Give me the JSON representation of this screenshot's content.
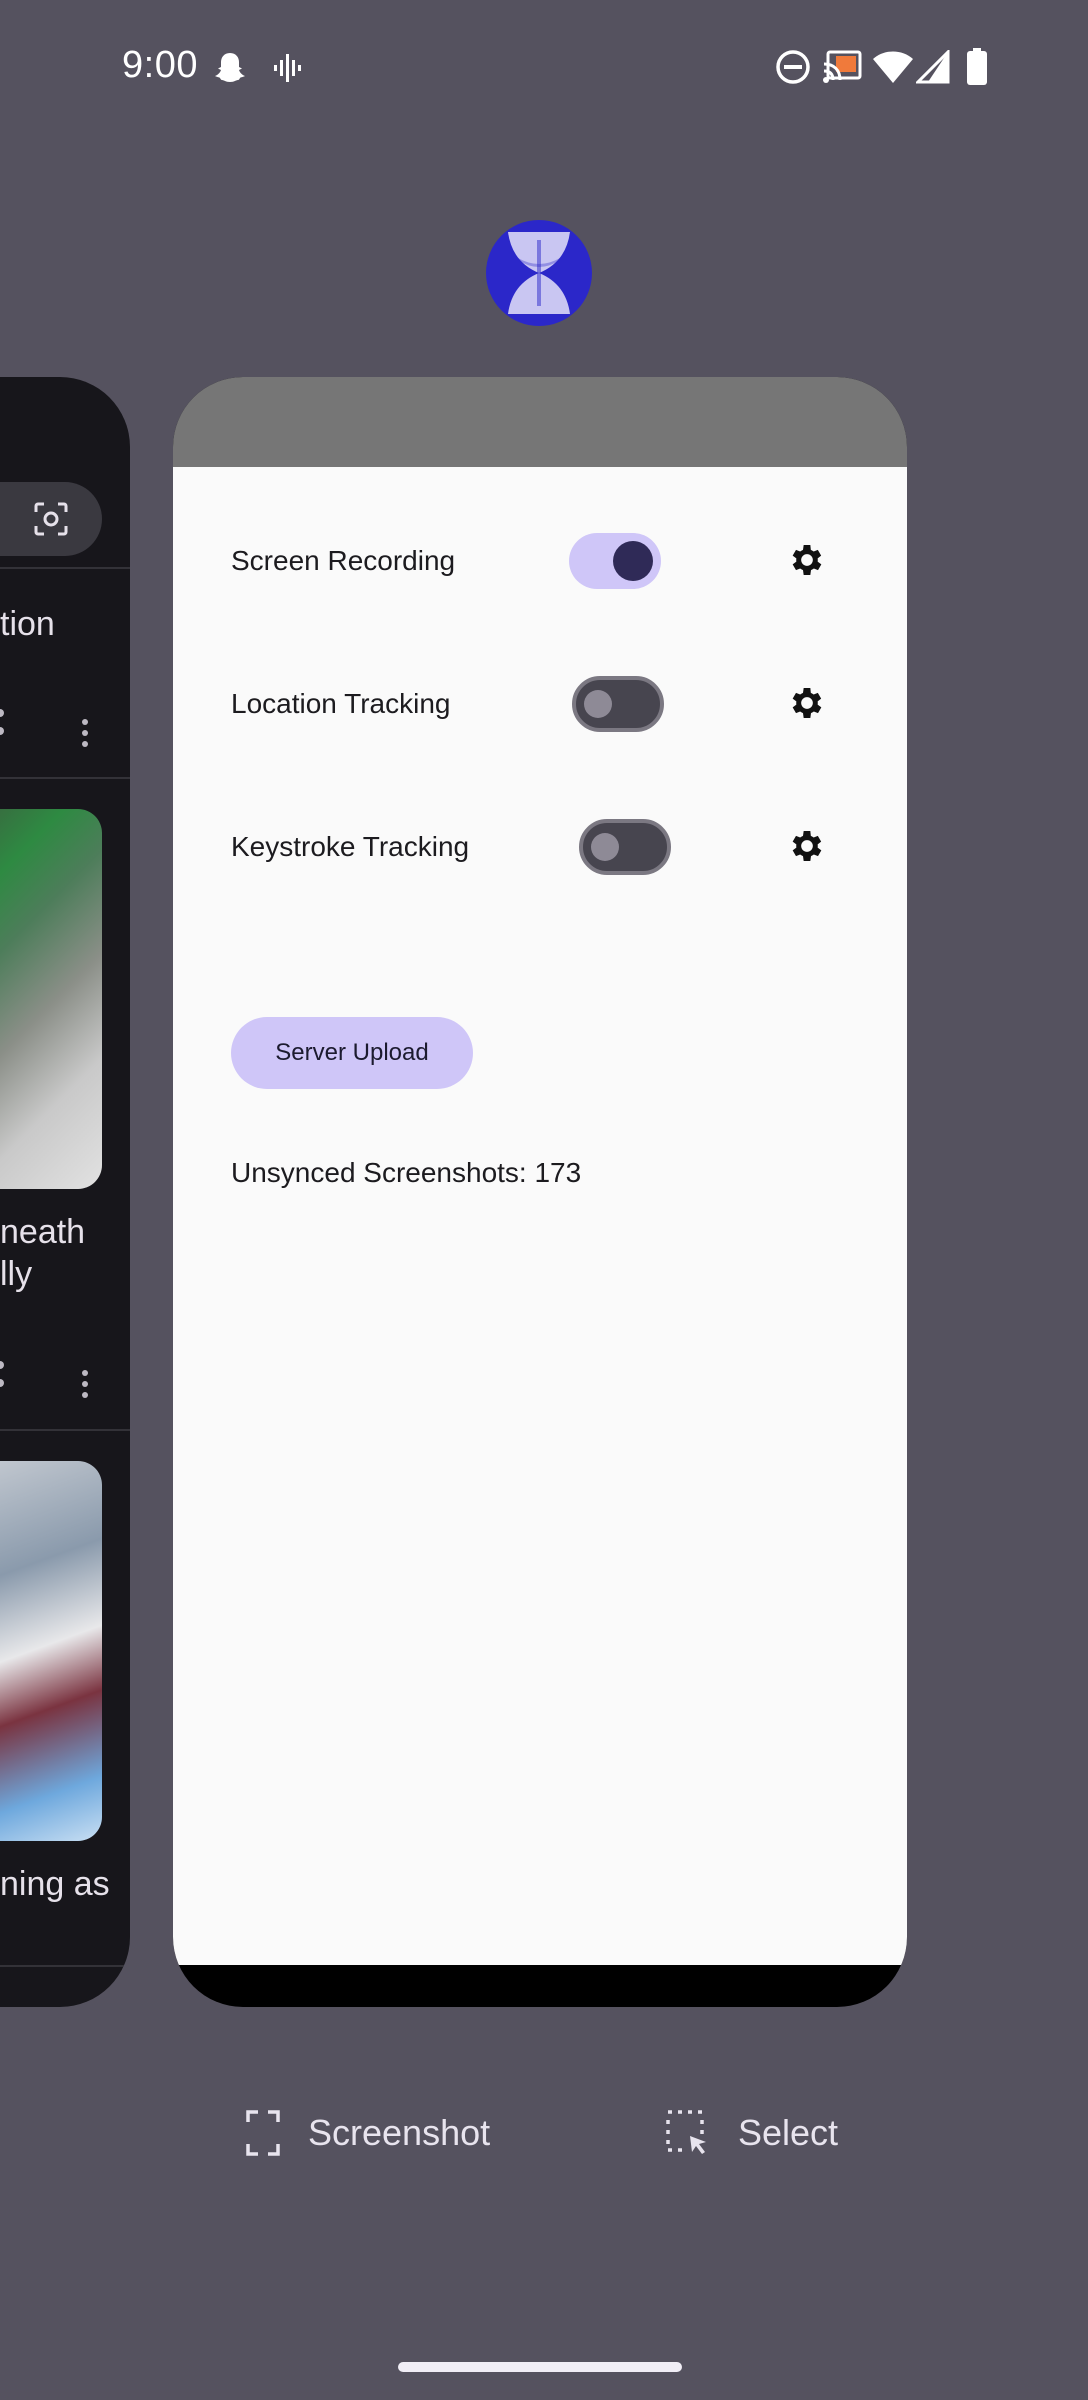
{
  "status_bar": {
    "time": "9:00",
    "left_icons": [
      "snapchat-icon",
      "voice-activity-icon"
    ],
    "right_icons": [
      "do-not-disturb-icon",
      "cast-icon",
      "wifi-icon",
      "cellular-icon",
      "battery-icon"
    ]
  },
  "background_card": {
    "snippets": [
      "tion",
      "neath",
      "lly",
      "ning as"
    ]
  },
  "app": {
    "header_color": "#767676",
    "toggles": [
      {
        "label": "Screen Recording",
        "on": true
      },
      {
        "label": "Location Tracking",
        "on": false
      },
      {
        "label": "Keystroke Tracking",
        "on": false
      }
    ],
    "upload_button": "Server Upload",
    "unsynced_text": "Unsynced Screenshots: 173"
  },
  "actions": {
    "screenshot": "Screenshot",
    "select": "Select"
  },
  "colors": {
    "background": "#55525f",
    "accent": "#cfc6f8",
    "toggle_knob_on": "#2f2a57"
  }
}
